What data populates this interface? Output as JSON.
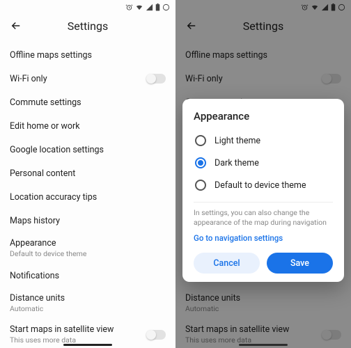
{
  "status": {
    "icons": [
      "alarm",
      "wifi",
      "signal",
      "battery",
      "circle"
    ]
  },
  "header": {
    "title": "Settings"
  },
  "list": {
    "items": [
      {
        "label": "Offline maps settings"
      },
      {
        "label": "Wi-Fi only",
        "toggle": true
      },
      {
        "label": "Commute settings"
      },
      {
        "label": "Edit home or work"
      },
      {
        "label": "Google location settings"
      },
      {
        "label": "Personal content"
      },
      {
        "label": "Location accuracy tips"
      },
      {
        "label": "Maps history"
      },
      {
        "label": "Appearance",
        "sub": "Default to device theme"
      },
      {
        "label": "Notifications"
      },
      {
        "label": "Distance units",
        "sub": "Automatic"
      },
      {
        "label": "Start maps in satellite view",
        "sub": "This uses more data",
        "toggle": true
      }
    ]
  },
  "dialog": {
    "title": "Appearance",
    "options": [
      {
        "label": "Light theme",
        "selected": false
      },
      {
        "label": "Dark theme",
        "selected": true
      },
      {
        "label": "Default to device theme",
        "selected": false
      }
    ],
    "note": "In settings, you can also change the appearance of the map during navigation",
    "link": "Go to navigation settings",
    "cancel": "Cancel",
    "save": "Save"
  },
  "colors": {
    "accent": "#1a73e8"
  }
}
